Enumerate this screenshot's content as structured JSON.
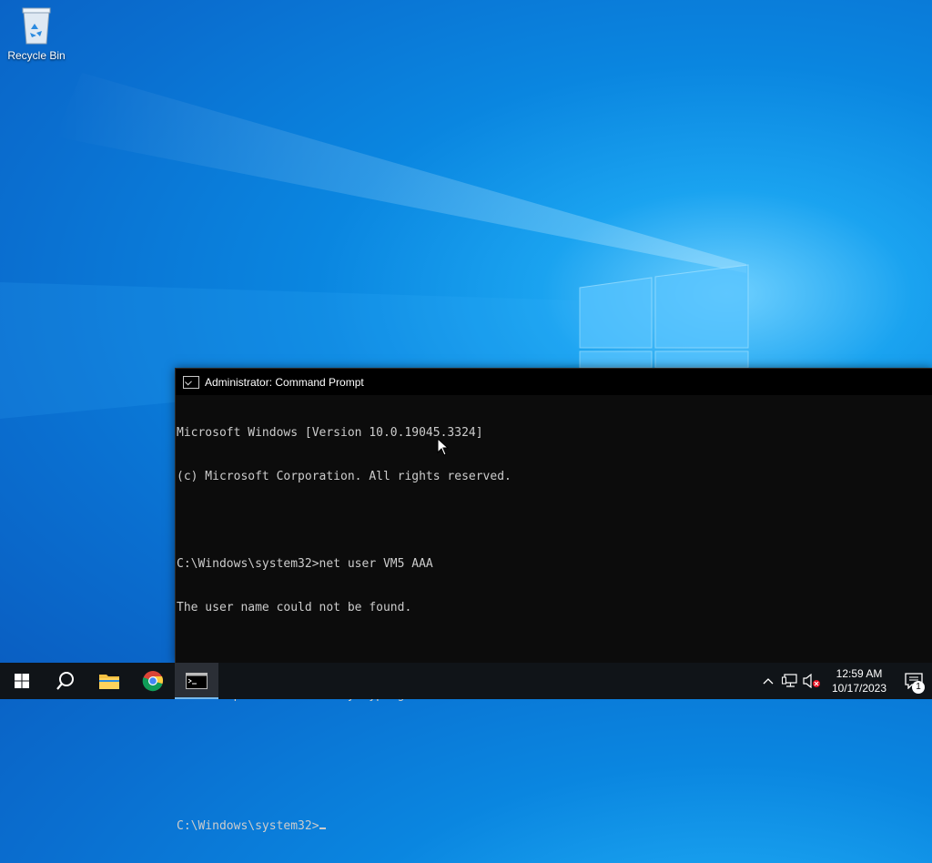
{
  "desktop": {
    "icons": [
      {
        "label": "Recycle Bin",
        "icon": "recycle-bin-icon"
      }
    ]
  },
  "cmd_window": {
    "title": "Administrator: Command Prompt",
    "lines": [
      "Microsoft Windows [Version 10.0.19045.3324]",
      "(c) Microsoft Corporation. All rights reserved.",
      "",
      "C:\\Windows\\system32>net user VM5 AAA",
      "The user name could not be found.",
      "",
      "More help is available by typing NET HELPMSG 2221.",
      "",
      ""
    ],
    "prompt": "C:\\Windows\\system32>"
  },
  "taskbar": {
    "buttons": [
      {
        "name": "start-button",
        "icon": "windows-logo-icon"
      },
      {
        "name": "search-button",
        "icon": "search-icon"
      },
      {
        "name": "file-explorer-button",
        "icon": "folder-icon"
      },
      {
        "name": "chrome-button",
        "icon": "chrome-icon"
      },
      {
        "name": "command-prompt-button",
        "icon": "cmd-icon",
        "active": true
      }
    ],
    "tray": {
      "icons": [
        "chevron-up-icon",
        "network-icon",
        "volume-muted-icon"
      ],
      "time": "12:59 AM",
      "date": "10/17/2023",
      "notification_count": "1"
    }
  },
  "colors": {
    "accent": "#76b9ed",
    "console_bg": "#0c0c0c",
    "console_text": "#cccccc",
    "taskbar_bg": "#101418"
  }
}
